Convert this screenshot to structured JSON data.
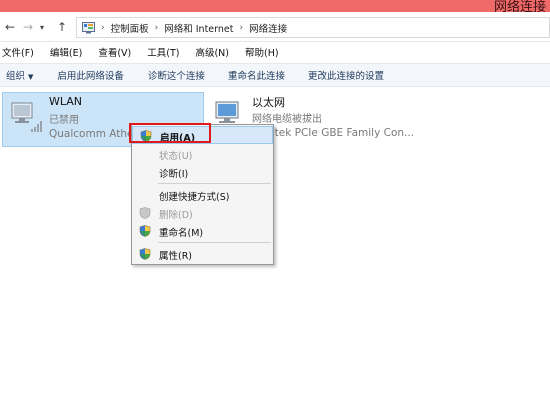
{
  "window": {
    "title": "网络连接"
  },
  "address": {
    "breadcrumbs": [
      "控制面板",
      "网络和 Internet",
      "网络连接"
    ]
  },
  "menubar": {
    "items": [
      "文件(F)",
      "编辑(E)",
      "查看(V)",
      "工具(T)",
      "高级(N)",
      "帮助(H)"
    ]
  },
  "toolbar": {
    "organize": "组织",
    "enable": "启用此网络设备",
    "diagnose": "诊断这个连接",
    "rename": "重命名此连接",
    "change": "更改此连接的设置"
  },
  "connections": [
    {
      "name": "WLAN",
      "status": "已禁用",
      "device": "Qualcomm Atheros"
    },
    {
      "name": "以太网",
      "status": "网络电缆被拔出",
      "device": "Realtek PCIe GBE Family Con..."
    }
  ],
  "context_menu": {
    "items": [
      {
        "label": "启用(A)",
        "icon": "shield-icon",
        "enabled": true,
        "bold": true
      },
      {
        "label": "状态(U)",
        "icon": "",
        "enabled": false
      },
      {
        "label": "诊断(I)",
        "icon": "",
        "enabled": true
      },
      {
        "label": "创建快捷方式(S)",
        "icon": "",
        "enabled": true
      },
      {
        "label": "删除(D)",
        "icon": "shield-icon",
        "enabled": false
      },
      {
        "label": "重命名(M)",
        "icon": "shield-icon",
        "enabled": true
      },
      {
        "label": "属性(R)",
        "icon": "shield-icon",
        "enabled": true
      }
    ]
  },
  "colors": {
    "titlebar": "#f06a6a",
    "selection": "#cce4f7",
    "highlight_box": "#e01a1a",
    "toolbar_text": "#1e395b"
  }
}
